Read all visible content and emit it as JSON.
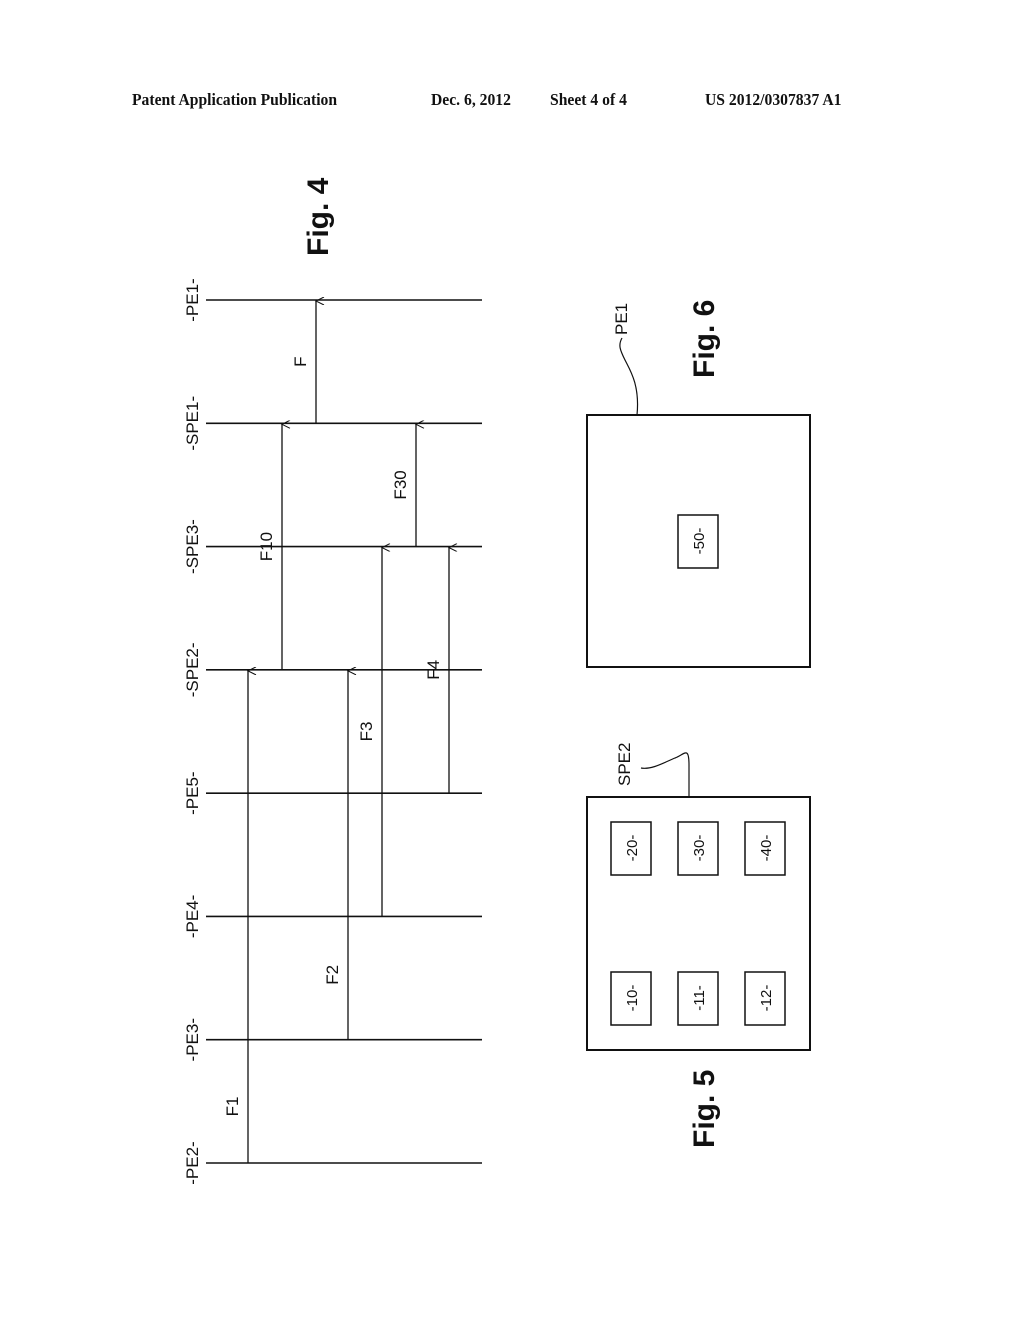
{
  "header": {
    "publication_type": "Patent Application Publication",
    "date": "Dec. 6, 2012",
    "sheet": "Sheet 4 of 4",
    "patent_number": "US 2012/0307837 A1"
  },
  "fig4": {
    "title": "Fig. 4",
    "levels": [
      "-PE2-",
      "-PE3-",
      "-PE4-",
      "-PE5-",
      "-SPE2-",
      "-SPE3-",
      "-SPE1-",
      "-PE1-"
    ],
    "arrows": [
      {
        "label": "F1",
        "from": "-PE2-",
        "to": "-SPE2-"
      },
      {
        "label": "F2",
        "from": "-PE3-",
        "to": "-SPE2-"
      },
      {
        "label": "F3",
        "from": "-PE4-",
        "to": "-SPE3-"
      },
      {
        "label": "F4",
        "from": "-PE5-",
        "to": "-SPE3-"
      },
      {
        "label": "F10",
        "from": "-SPE2-",
        "to": "-SPE1-"
      },
      {
        "label": "F30",
        "from": "-SPE3-",
        "to": "-SPE1-"
      },
      {
        "label": "F",
        "from": "-SPE1-",
        "to": "-PE1-"
      }
    ]
  },
  "fig5": {
    "title": "Fig. 5",
    "element_label": "SPE2",
    "modules": [
      "-20-",
      "-30-",
      "-40-",
      "-10-",
      "-11-",
      "-12-"
    ]
  },
  "fig6": {
    "title": "Fig. 6",
    "element_label": "PE1",
    "modules": [
      "-50-"
    ]
  }
}
